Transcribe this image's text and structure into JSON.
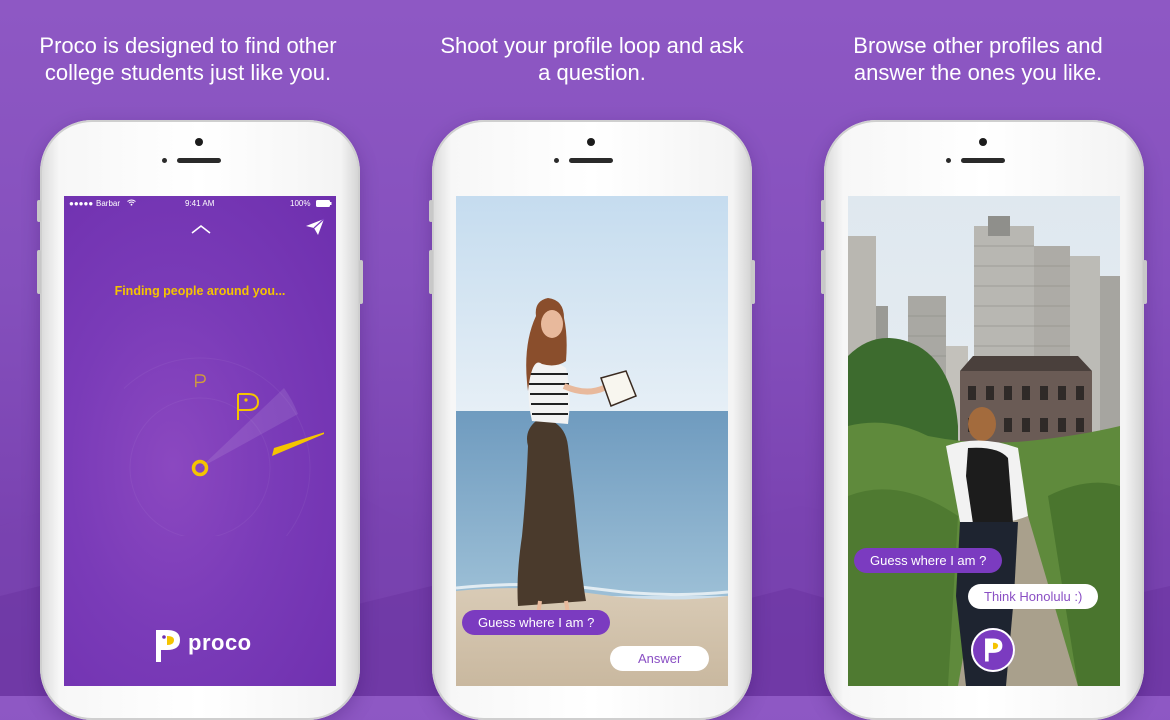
{
  "captions": [
    "Proco is designed to find other\ncollege students just like you.",
    "Shoot your profile loop and ask\na question.",
    "Browse other profiles and\nanswer the ones you like."
  ],
  "phone1": {
    "status": {
      "carrier": "Barbar",
      "time": "9:41 AM",
      "battery": "100%"
    },
    "finding_text": "Finding people around you...",
    "brand": "proco",
    "icons": {
      "up": "chevron-up-icon",
      "send": "paper-plane-icon",
      "logo": "proco-logo-icon"
    }
  },
  "phone2": {
    "question_bubble": "Guess where I am ?",
    "answer_bubble": "Answer"
  },
  "phone3": {
    "question_bubble": "Guess where I am ?",
    "answer_bubble": "Think Honolulu :)"
  },
  "colors": {
    "brand_purple": "#7b3bc0",
    "accent_yellow": "#f5c400",
    "background": "#8a55c2"
  }
}
